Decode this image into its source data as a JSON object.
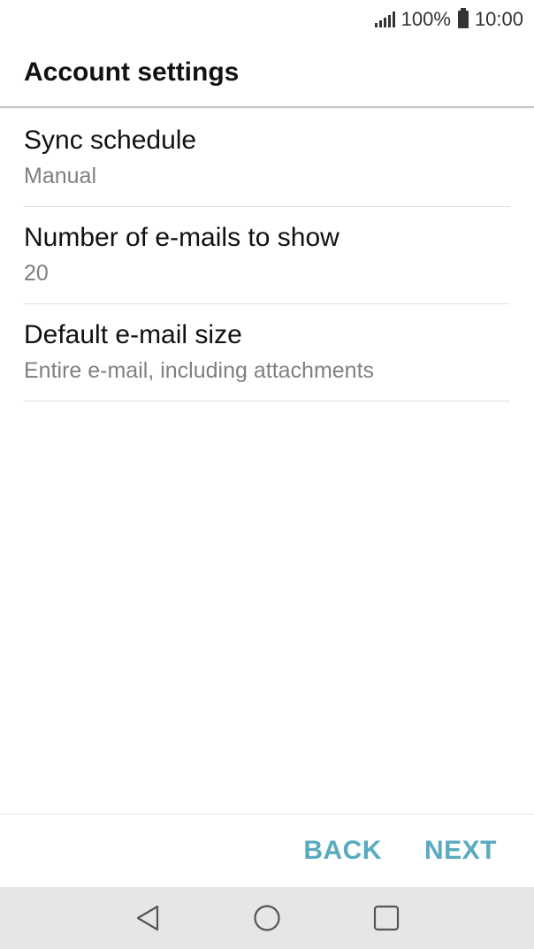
{
  "status_bar": {
    "battery_percent": "100%",
    "time": "10:00",
    "icons": [
      "signal-icon",
      "battery-icon"
    ]
  },
  "header": {
    "title": "Account settings"
  },
  "settings": [
    {
      "title": "Sync schedule",
      "value": "Manual"
    },
    {
      "title": "Number of e-mails to show",
      "value": "20"
    },
    {
      "title": "Default e-mail size",
      "value": "Entire e-mail, including attachments"
    }
  ],
  "actions": {
    "back_label": "BACK",
    "next_label": "NEXT"
  },
  "nav_bar": {
    "icons": [
      "back-triangle-icon",
      "home-circle-icon",
      "recents-square-icon"
    ]
  },
  "colors": {
    "accent": "#5aaac0",
    "secondary_text": "#808080",
    "nav_background": "#e6e6e6"
  }
}
